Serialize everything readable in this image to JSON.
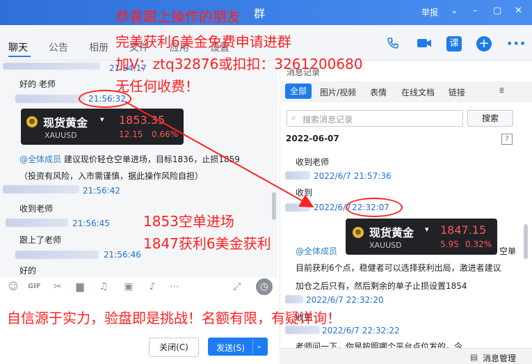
{
  "window": {
    "title": "群",
    "report": "举报",
    "controls": [
      "⌄",
      "–",
      "▢",
      "✕"
    ]
  },
  "nav": {
    "tabs": [
      "聊天",
      "公告",
      "相册",
      "文件",
      "应用",
      "设置"
    ]
  },
  "top_icons": [
    "phone-icon",
    "video-icon",
    "classroom-icon",
    "add-icon",
    "more-icon"
  ],
  "chat": {
    "messages": [
      {
        "time": "21:54:17",
        "text": "好的  老师"
      },
      {
        "time": "21:56:32"
      },
      {
        "mention": "@全体成员",
        "text": " 建议现价轻仓空单进场，目标1836，止损1859"
      },
      {
        "text": "（投资有风险，入市需谨慎，据此操作风险自担）"
      },
      {
        "time": "21:56:42",
        "text": "收到老师"
      },
      {
        "time": "21:56:45",
        "text": "跟上了老师"
      },
      {
        "time": "21:56:46",
        "text": "好的"
      }
    ],
    "gold_card_left": {
      "name": "现货黄金",
      "code": "XAUUSD",
      "price": "1853.35",
      "change": "12.15",
      "change_pct": "0.66%"
    }
  },
  "composer": {
    "close_label": "关闭(C)",
    "send_label": "发送(S)"
  },
  "history": {
    "title": "消息记录",
    "tabs": [
      "全部",
      "图片/视频",
      "表情",
      "在线文档",
      "链接"
    ],
    "search_placeholder": "搜索消息记录",
    "search_btn": "搜索",
    "date": "2022-06-07",
    "items": [
      {
        "text": "收到老师"
      },
      {
        "time": "2022/6/7 21:57:36",
        "text": "收到"
      },
      {
        "time_a": "2022/6/7",
        "time_b": "22:32:07"
      },
      {
        "mention": "@全体成员",
        "trail": "空单"
      },
      {
        "text": "目前获利6个点，稳健者可以选择获利出局，激进者建议"
      },
      {
        "text": "加仓之后只有，然后剩余的单子止损设置1854"
      },
      {
        "time": "2022/6/7 22:32:20",
        "text": "收到"
      },
      {
        "time": "2022/6/7 22:32:22",
        "text": "老师问一下，你是按照哪个平台点位发的，今"
      }
    ],
    "gold_card_right": {
      "name": "现货黄金",
      "code": "XAUUSD",
      "price": "1847.15",
      "change": "5.95",
      "change_pct": "0.32%"
    },
    "manage": "消息管理"
  },
  "overlay": {
    "line1": "恭喜跟上操作的朋友",
    "line2": "完美获利6美金免费申请进群",
    "line3": "加V：ztq32876或扣扣：3261200680",
    "line4": "无任何收费！",
    "mid1": "1853空单进场",
    "mid2": "1847获利6美金获利",
    "bottom": "自信源于实力，验盘即是挑战！名额有限，有疑详询！"
  }
}
